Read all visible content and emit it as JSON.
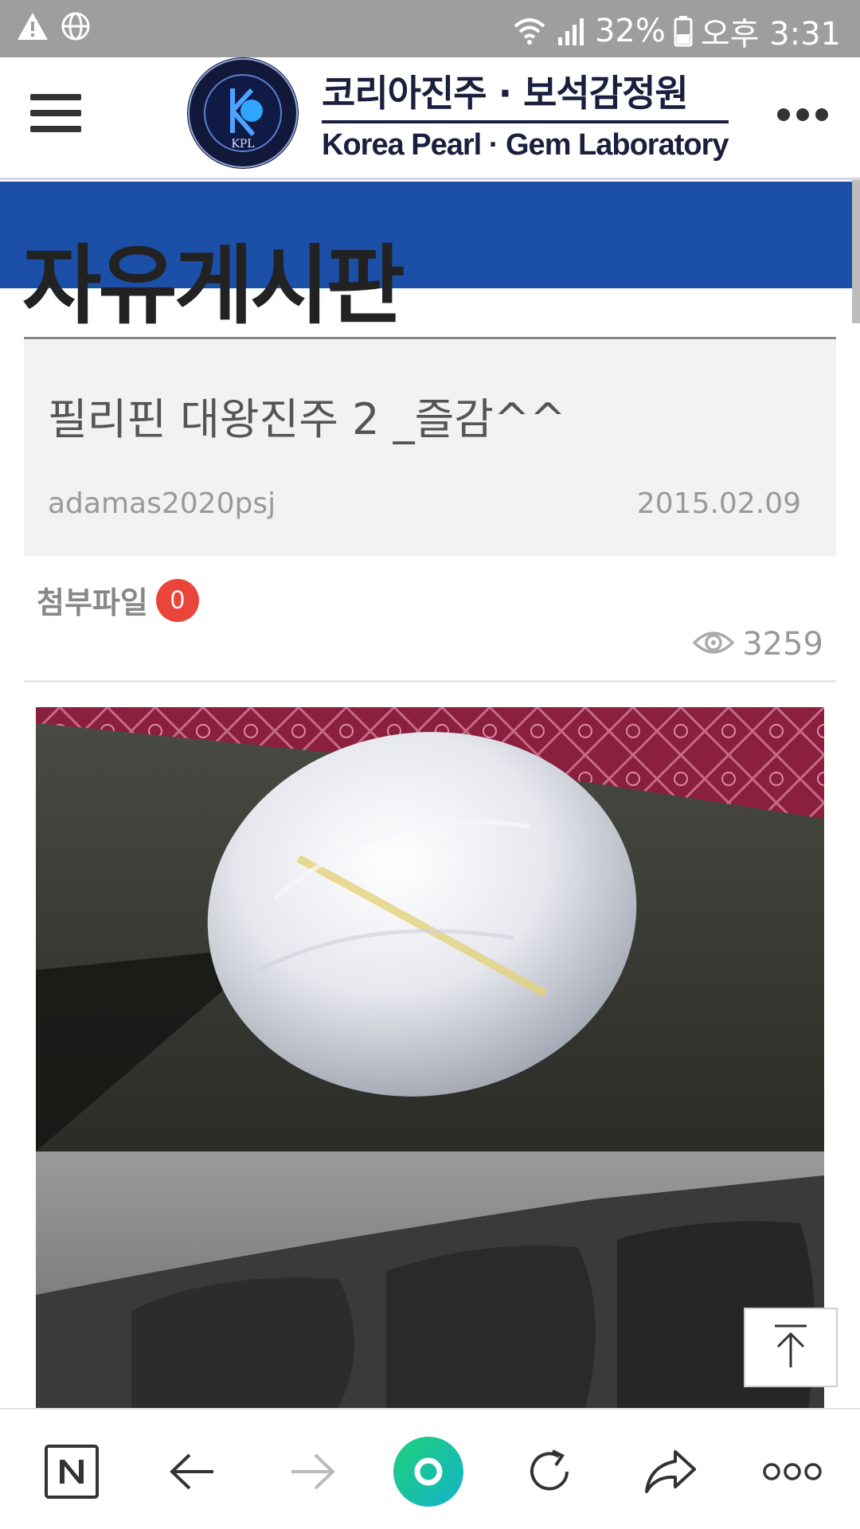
{
  "status_bar": {
    "battery": "32%",
    "time": "오후 3:31"
  },
  "header": {
    "logo_ko": "코리아진주 · 보석감정원",
    "logo_en": "Korea Pearl · Gem Laboratory",
    "emblem_text": "KPL",
    "emblem_ring_text": "코리아진주 · 보석감정원 · Korea Pearl · Gem Laboratory"
  },
  "board": {
    "title": "자유게시판"
  },
  "post": {
    "title": "필리핀 대왕진주 2 _즐감^^",
    "author": "adamas2020psj",
    "date": "2015.02.09",
    "attachment_label": "첨부파일",
    "attachment_count": "0",
    "views": "3259"
  },
  "icons": {
    "warning": "warning-icon",
    "globe": "globe-icon",
    "wifi": "wifi-icon",
    "signal": "signal-icon",
    "battery": "battery-icon",
    "eye": "eye-icon",
    "to_top": "arrow-to-top-icon",
    "naver": "naver-n-icon",
    "back": "arrow-left-icon",
    "forward": "arrow-right-icon",
    "home": "green-ring-icon",
    "reload": "reload-icon",
    "share": "share-icon",
    "more": "more-icon"
  },
  "colors": {
    "status_bar": "#9e9e9e",
    "banner": "#1b4fa8",
    "badge": "#e9453b",
    "brand_dark": "#1a1f3d",
    "green_button": "#16c39a"
  }
}
